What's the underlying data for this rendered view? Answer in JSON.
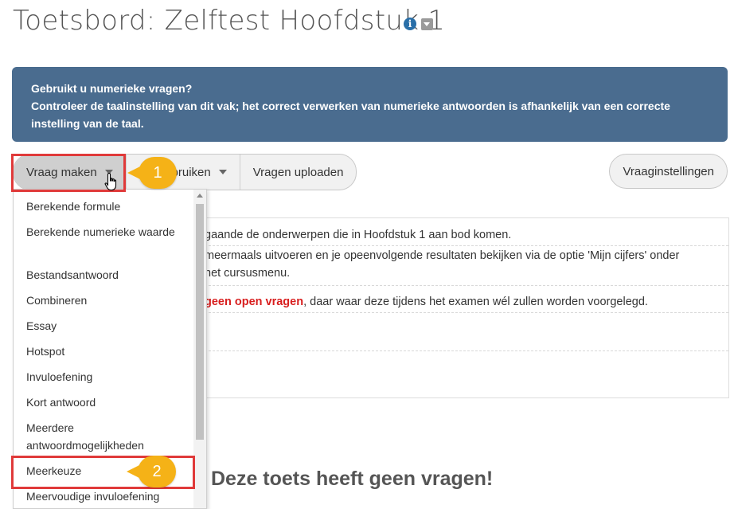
{
  "page": {
    "title": "Toetsbord: Zelftest Hoofdstuk 1",
    "info_glyph": "i"
  },
  "alert": {
    "line1": "Gebruikt u numerieke vragen?",
    "line2": "Controleer de taalinstelling van dit vak; het correct verwerken van numerieke antwoorden is afhankelijk van een correcte instelling van de taal."
  },
  "toolbar": {
    "create_label": "Vraag maken",
    "reuse_label": "Hergebruiken",
    "upload_label": "Vragen uploaden",
    "settings_label": "Vraaginstellingen"
  },
  "info": {
    "line1": "gaande de onderwerpen die in Hoofdstuk 1 aan bod komen.",
    "line2a": "meermaals uitvoeren en je opeenvolgende resultaten bekijken via de optie 'Mijn cijfers' onder",
    "line2b": "het cursusmenu.",
    "line3_red": "geen open vragen",
    "line3_rest": ", daar waar deze tijdens het examen wél zullen worden voorgelegd."
  },
  "empty_message": "Deze toets heeft geen vragen!",
  "menu": {
    "items": [
      "Berekende formule",
      "Berekende numerieke waarde",
      "Bestandsantwoord",
      "Combineren",
      "Essay",
      "Hotspot",
      "Invuloefening",
      "Kort antwoord",
      "Meerdere antwoordmogelijkheden",
      "Meerkeuze",
      "Meervoudige invuloefening"
    ]
  },
  "callouts": [
    "1",
    "2"
  ],
  "colors": {
    "alert_bg": "#4a6c8f",
    "callout": "#f5b217",
    "highlight": "#e03a3a",
    "emphasis_red": "#d81e1e"
  },
  "icons": [
    "info-icon",
    "dropdown-icon",
    "caret-down-icon",
    "hand-cursor-icon",
    "scroll-up-icon"
  ]
}
